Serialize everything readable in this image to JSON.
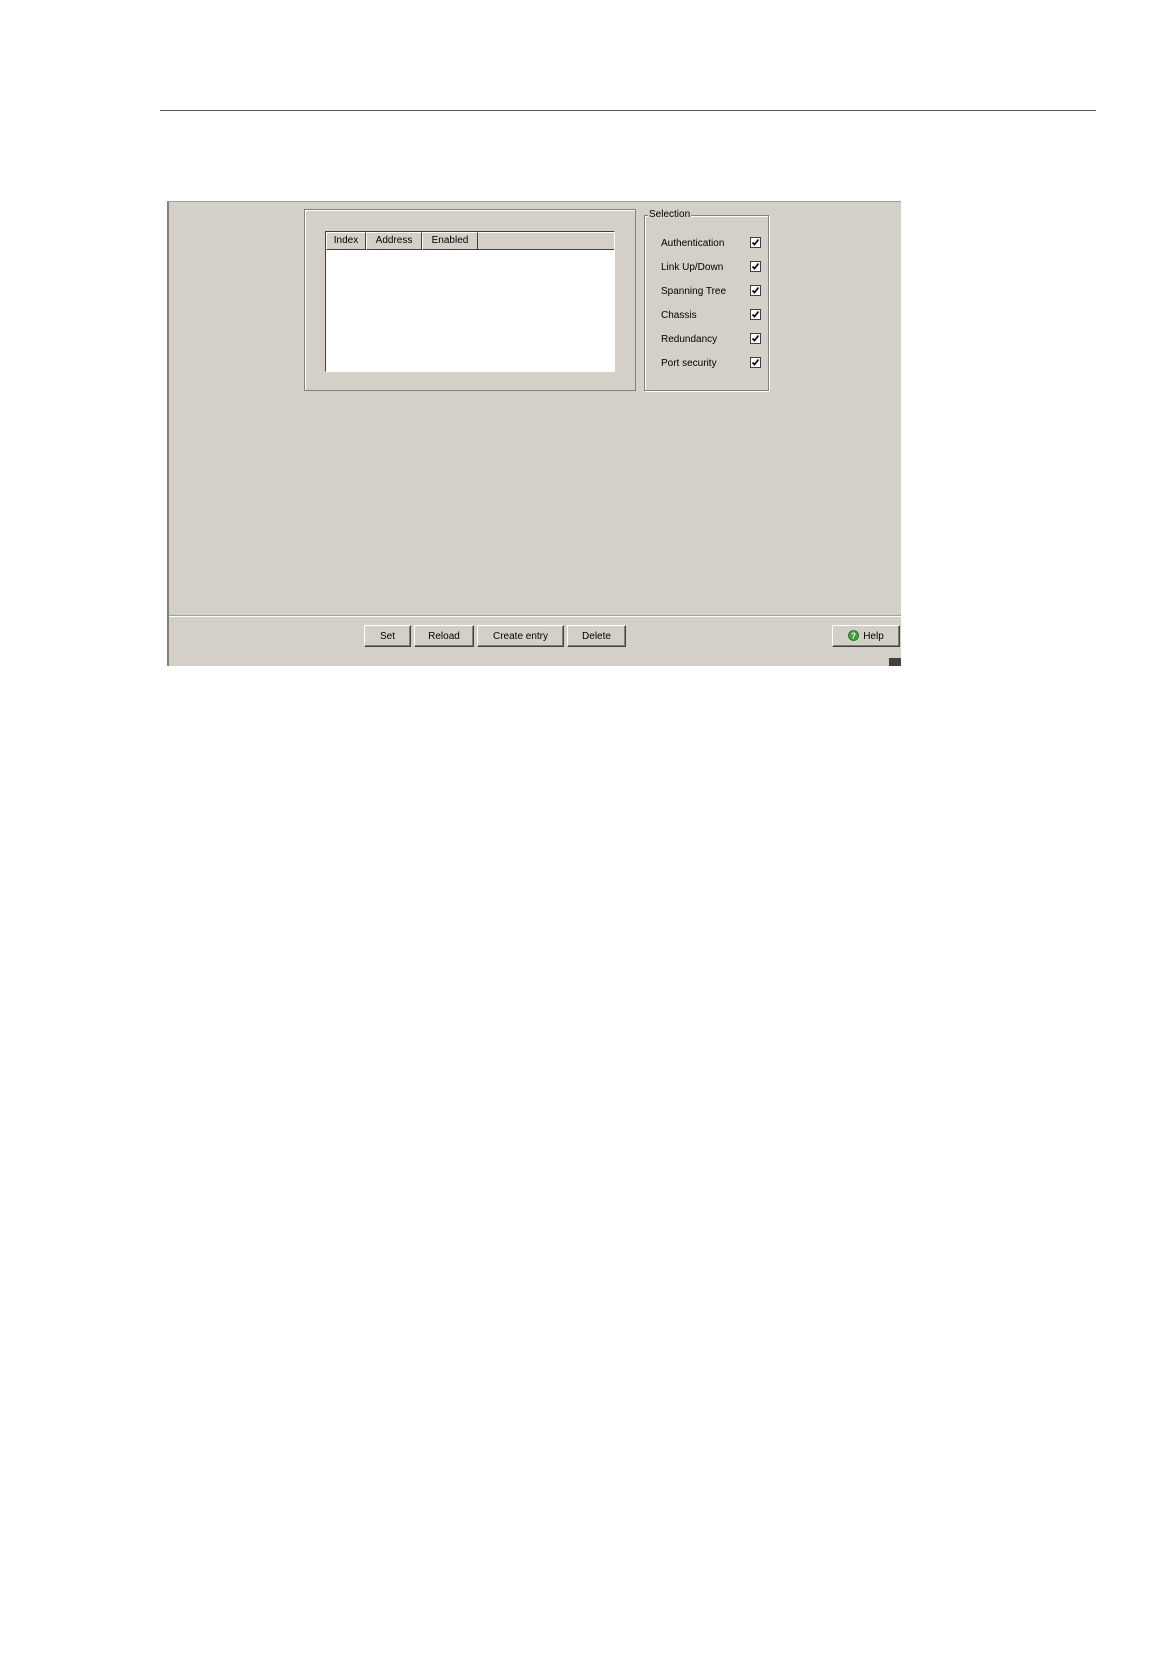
{
  "table": {
    "columns": [
      "Index",
      "Address",
      "Enabled"
    ],
    "rows": []
  },
  "selection": {
    "legend": "Selection",
    "items": [
      {
        "label": "Authentication",
        "checked": true
      },
      {
        "label": "Link Up/Down",
        "checked": true
      },
      {
        "label": "Spanning Tree",
        "checked": true
      },
      {
        "label": "Chassis",
        "checked": true
      },
      {
        "label": "Redundancy",
        "checked": true
      },
      {
        "label": "Port security",
        "checked": true
      }
    ]
  },
  "buttons": {
    "set": "Set",
    "reload": "Reload",
    "create_entry": "Create entry",
    "delete": "Delete",
    "help": "Help"
  },
  "icons": {
    "help": "help-icon",
    "check": "checkmark-icon"
  },
  "colors": {
    "panel_bg": "#d4d0c8",
    "help_icon": "#3aa53a"
  }
}
